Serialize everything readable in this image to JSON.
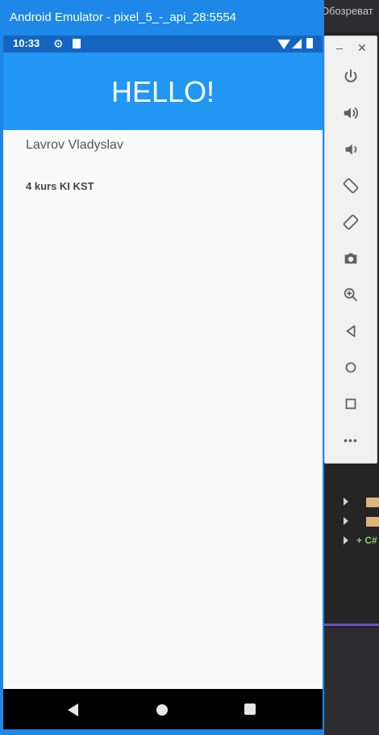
{
  "ide": {
    "title_fragment": "Обозреват"
  },
  "emulator": {
    "window_title": "Android Emulator - pixel_5_-_api_28:5554",
    "status": {
      "time": "10:33"
    },
    "app": {
      "title": "HELLO!",
      "name": "Lavrov Vladyslav",
      "course": "4 kurs KI KST"
    },
    "colors": {
      "title_bar": "#1d88e8",
      "status_bar": "#1565c0",
      "app_bar": "#2196f3",
      "content_bg": "#fafafa"
    }
  },
  "toolbar": {
    "minimize": "–",
    "close": "✕",
    "buttons": [
      {
        "icon": "power-icon"
      },
      {
        "icon": "volume-up-icon"
      },
      {
        "icon": "volume-down-icon"
      },
      {
        "icon": "rotate-left-icon"
      },
      {
        "icon": "rotate-right-icon"
      },
      {
        "icon": "camera-icon"
      },
      {
        "icon": "zoom-icon"
      },
      {
        "icon": "back-icon"
      },
      {
        "icon": "home-icon"
      },
      {
        "icon": "overview-icon"
      },
      {
        "icon": "more-icon"
      }
    ],
    "more_label": "•••"
  }
}
